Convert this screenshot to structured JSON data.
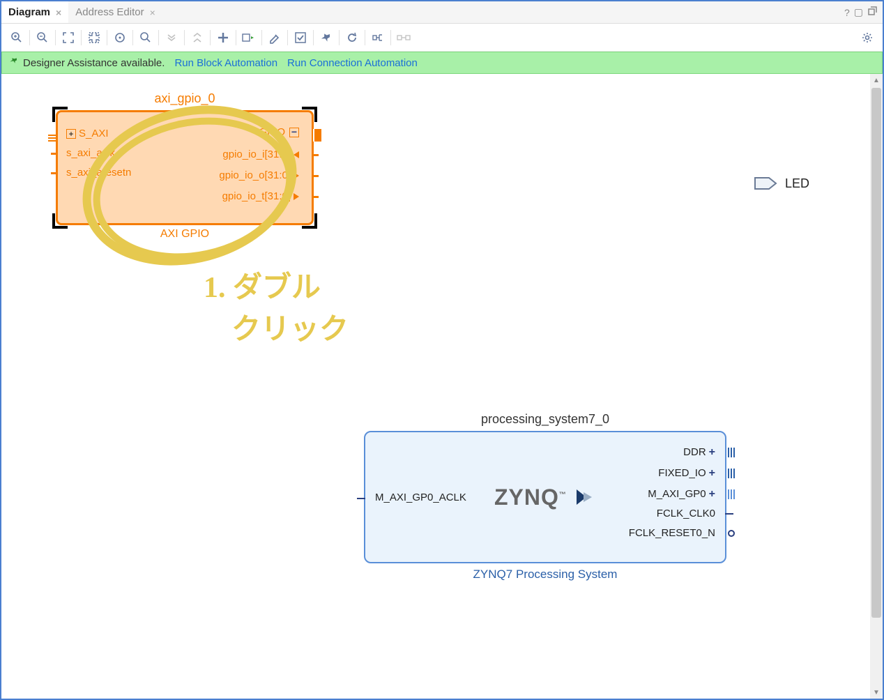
{
  "tabs": {
    "diagram": "Diagram",
    "address_editor": "Address Editor"
  },
  "assist": {
    "text": "Designer Assistance available.",
    "run_block": "Run Block Automation",
    "run_conn": "Run Connection Automation"
  },
  "gpio": {
    "instance": "axi_gpio_0",
    "type": "AXI GPIO",
    "ports": {
      "s_axi": "S_AXI",
      "aclk": "s_axi_aclk",
      "aresetn": "s_axi_aresetn",
      "gpio_hdr": "GPIO",
      "gpio_i": "gpio_io_i[31:0]",
      "gpio_o": "gpio_io_o[31:0]",
      "gpio_t": "gpio_io_t[31:0]"
    }
  },
  "zynq": {
    "instance": "processing_system7_0",
    "type": "ZYNQ7 Processing System",
    "logo": "ZYNQ",
    "ports": {
      "m_aclk": "M_AXI_GP0_ACLK",
      "ddr": "DDR",
      "fixed_io": "FIXED_IO",
      "m_axi": "M_AXI_GP0",
      "fclk0": "FCLK_CLK0",
      "freset": "FCLK_RESET0_N"
    }
  },
  "led": {
    "label": "LED"
  },
  "annotation": {
    "text": "1. ダブル クリック"
  }
}
